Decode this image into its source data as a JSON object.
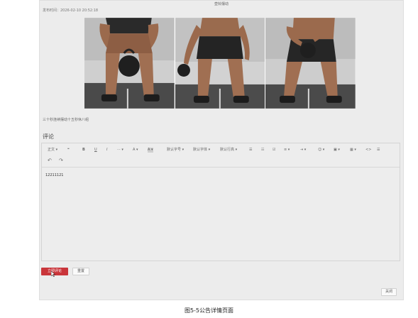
{
  "dialog": {
    "title": "壶铃摆动",
    "publish_time": "发布时间：2026-02-10 20:52:18",
    "photos": [
      {
        "icon": "kettlebell-squat-photo"
      },
      {
        "icon": "kettlebell-swing-photo"
      },
      {
        "icon": "kettlebell-jump-photo"
      }
    ],
    "description": "三十秒连续摆动十五秒休八组"
  },
  "comment": {
    "section_title": "评论",
    "toolbar": {
      "paragraph": "正文 ▾",
      "quote": "❝",
      "bold": "B",
      "underline": "U",
      "italic": "I",
      "more": "··· ▾",
      "font_color": "A ▾",
      "bg_color": "A ▾",
      "font_size": "默认字号 ▾",
      "font_family": "默认字体 ▾",
      "line_height": "默认行高 ▾",
      "bullet_list": "☰",
      "numbered_list": "☷",
      "todo": "☑",
      "align": "≡ ▾",
      "indent": "⇥ ▾",
      "emoji": "☺ ▾",
      "image": "▣ ▾",
      "table": "▦ ▾",
      "code": "<>",
      "divider": "☰",
      "undo": "↶",
      "redo": "↷"
    },
    "content": "12211121"
  },
  "buttons": {
    "submit": "立即评论",
    "reset": "重置",
    "close": "关闭"
  },
  "figure_caption": "图5-5公告详情页面"
}
